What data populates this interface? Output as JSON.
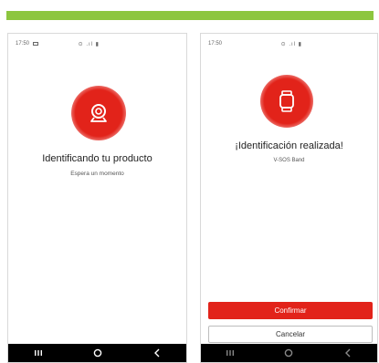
{
  "colors": {
    "top_bar": "#8dc63f",
    "accent": "#e2231a",
    "nav_bar": "#000000"
  },
  "screen_left": {
    "status_time": "17:50",
    "status_icons": "⊙ .ıl ▮",
    "icon": "camera-icon",
    "title": "Identificando tu producto",
    "subtitle": "Espera un momento"
  },
  "screen_right": {
    "status_time": "17:50",
    "status_icons": "⊙ .ıl ▮",
    "icon": "smartwatch-icon",
    "title": "¡Identificación realizada!",
    "subtitle": "V-SOS Band",
    "confirm_label": "Confirmar",
    "cancel_label": "Cancelar"
  },
  "nav_icons": [
    "recent-apps-icon",
    "home-icon",
    "back-icon"
  ]
}
